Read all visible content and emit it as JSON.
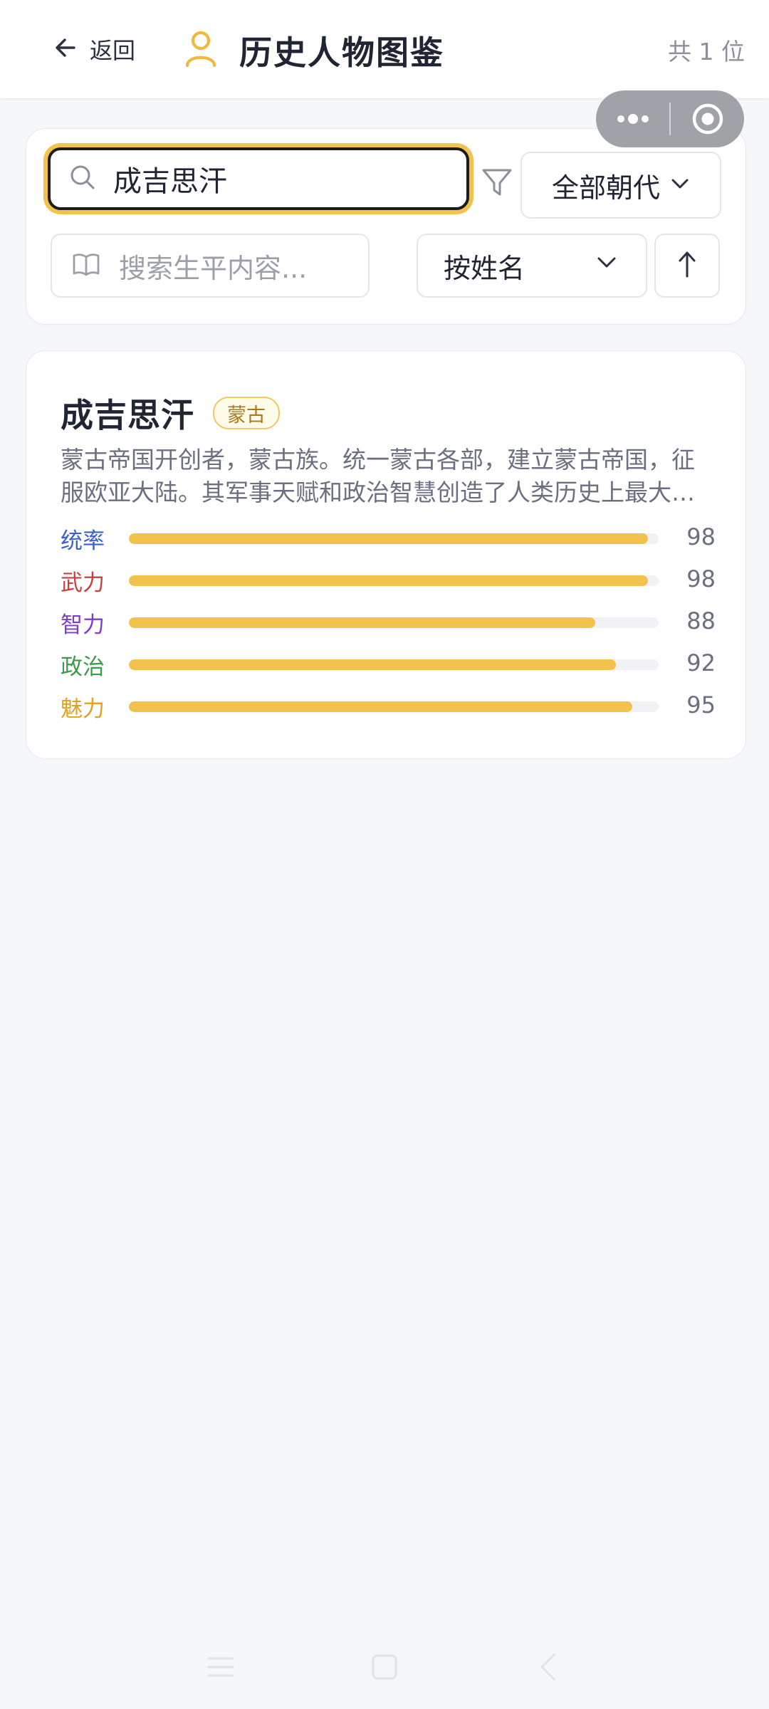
{
  "header": {
    "back_label": "返回",
    "title": "历史人物图鉴",
    "count_text": "共 1 位",
    "accent": "#f0b93b"
  },
  "capsule": {
    "more_icon": "more-dots-icon",
    "close_icon": "target-circle-icon"
  },
  "filters": {
    "search_value": "成吉思汗",
    "search_icon": "search-icon",
    "filter_icon": "funnel-icon",
    "dynasty_selected": "全部朝代",
    "bio_placeholder": "搜索生平内容...",
    "bio_icon": "book-icon",
    "sort_selected": "按姓名",
    "sort_order_icon": "arrow-up-icon"
  },
  "people": [
    {
      "name": "成吉思汗",
      "dynasty": "蒙古",
      "bio": "蒙古帝国开创者，蒙古族。统一蒙古各部，建立蒙古帝国，征服欧亚大陆。其军事天赋和政治智慧创造了人类历史上最大的陆上帝国。",
      "stats": [
        {
          "label": "统率",
          "value": 98,
          "color": "#3a62c9"
        },
        {
          "label": "武力",
          "value": 98,
          "color": "#cc3f3f"
        },
        {
          "label": "智力",
          "value": 88,
          "color": "#7d3fc8"
        },
        {
          "label": "政治",
          "value": 92,
          "color": "#3f9a4a"
        },
        {
          "label": "魅力",
          "value": 95,
          "color": "#e2a020"
        }
      ]
    }
  ],
  "system_nav": {
    "menu_icon": "menu-icon",
    "home_icon": "home-square-icon",
    "back_icon": "back-chevron-icon"
  }
}
